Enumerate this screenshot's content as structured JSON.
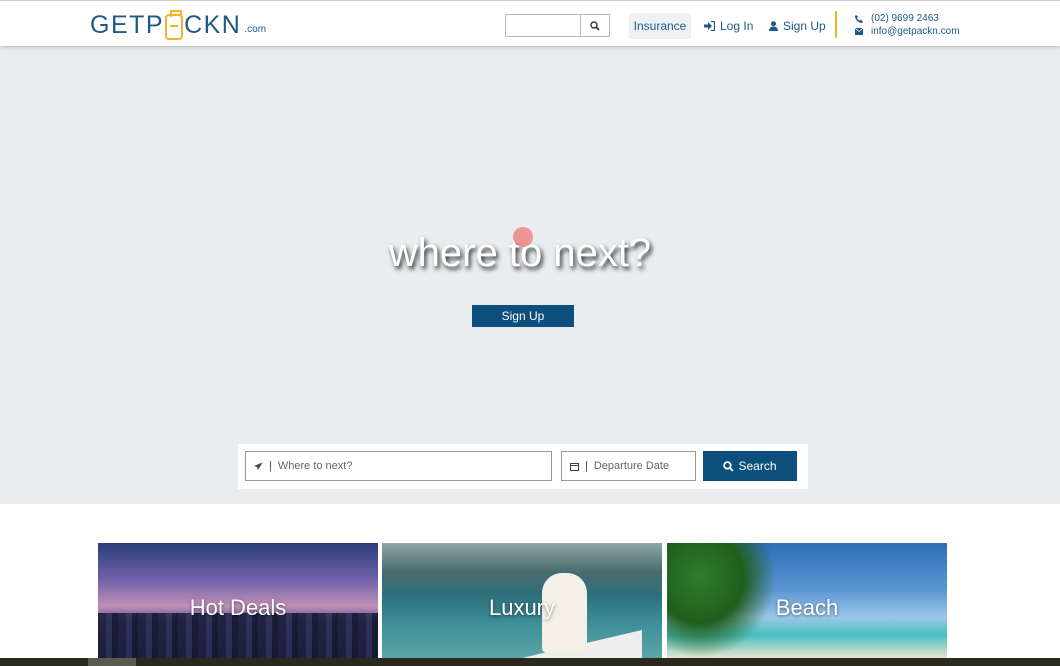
{
  "header": {
    "logo": {
      "text_left": "GETP",
      "text_right": "CKN",
      "suffix": ".com"
    },
    "search": {
      "value": "",
      "placeholder": ""
    },
    "nav": {
      "insurance": "Insurance",
      "login": "Log In",
      "signup": "Sign Up"
    },
    "contact": {
      "phone": "(02) 9699 2463",
      "email": "info@getpackn.com"
    }
  },
  "hero": {
    "title": "where to next?",
    "signup_button": "Sign Up"
  },
  "search_panel": {
    "destination_placeholder": "Where to next?",
    "date_placeholder": "Departure Date",
    "separator": "|",
    "search_button": "Search"
  },
  "tiles": [
    {
      "label": "Hot Deals"
    },
    {
      "label": "Luxury"
    },
    {
      "label": "Beach"
    }
  ],
  "colors": {
    "brand": "#1e5a86",
    "accent": "#f0b429",
    "button": "#0d4f7c",
    "hero_bg": "#e9edf0"
  },
  "icons": [
    "search-icon",
    "sign-in-icon",
    "user-icon",
    "phone-icon",
    "envelope-icon",
    "plane-icon",
    "calendar-icon"
  ]
}
